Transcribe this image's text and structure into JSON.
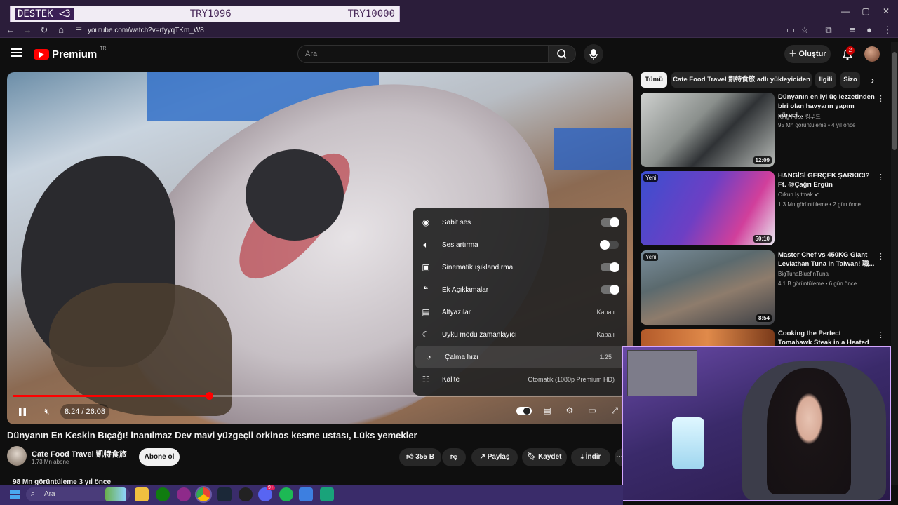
{
  "overlay_banner": {
    "left": "DESTEK <3",
    "mid": "TRY1096",
    "right": "TRY10000"
  },
  "browser": {
    "url": "youtube.com/watch?v=rfyyqTKm_W8",
    "window_buttons": [
      "—",
      "▢",
      "✕"
    ]
  },
  "header": {
    "logo": "Premium",
    "region": "TR",
    "search_placeholder": "Ara",
    "create_label": "Oluştur",
    "notifications": "2"
  },
  "player": {
    "time": "8:24 / 26:08",
    "progress": 0.322
  },
  "settings_menu": {
    "items": [
      {
        "label": "Sabit ses",
        "icon": "stable-volume-icon",
        "toggle": "on"
      },
      {
        "label": "Ses artırma",
        "icon": "volume-boost-icon",
        "toggle": "off"
      },
      {
        "label": "Sinematik ışıklandırma",
        "icon": "ambient-mode-icon",
        "toggle": "on"
      },
      {
        "label": "Ek Açıklamalar",
        "icon": "annotations-icon",
        "toggle": "on"
      },
      {
        "label": "Altyazılar",
        "icon": "subtitles-icon",
        "value": "Kapalı"
      },
      {
        "label": "Uyku modu zamanlayıcı",
        "icon": "sleep-timer-icon",
        "value": "Kapalı"
      },
      {
        "label": "Çalma hızı",
        "icon": "playback-speed-icon",
        "value": "1.25"
      },
      {
        "label": "Kalite",
        "icon": "quality-icon",
        "value": "Otomatik (1080p Premium HD)"
      }
    ]
  },
  "video": {
    "title": "Dünyanın En Keskin Bıçağı!  İnanılmaz Dev mavi yüzgeçli orkinos kesme ustası, Lüks yemekler",
    "channel": "Cate Food Travel 凱特食旅",
    "subscribers": "1,73 Mn abone",
    "subscribe_label": "Abone ol",
    "likes": "355 B",
    "share_label": "Paylaş",
    "save_label": "Kaydet",
    "download_label": "İndir",
    "views": "98 Mn görüntüleme  3 yıl önce"
  },
  "chips": [
    "Tümü",
    "Cate Food Travel 凱特食旅 adlı yükleyiciden",
    "İlgili",
    "Sizo"
  ],
  "recommendations": [
    {
      "title": "Dünyanın en iyi üç lezzetinden biri olan havyarın yapım süreci...",
      "channel": "King Food 킹푸드",
      "meta": "95 Mn görüntüleme • 4 yıl önce",
      "duration": "12:09",
      "badge": ""
    },
    {
      "title": "HANGİSİ GERÇEK ŞARKICI? Ft. @Çağrı Ergün",
      "channel": "Orkun Işıtmak ✔",
      "meta": "1,3 Mn görüntüleme • 2 gün önce",
      "duration": "50:10",
      "badge": "Yeni"
    },
    {
      "title": "Master Chef vs 450KG Giant Leviathan Tuna in Taiwan! 職...",
      "channel": "BigTunaBluefinTuna",
      "meta": "4,1 B görüntüleme • 6 gün önce",
      "duration": "8:54",
      "badge": "Yeni"
    },
    {
      "title": "Cooking the Perfect Tomahawk Steak in a Heated Forest Roc...",
      "channel": "",
      "meta": "",
      "duration": "",
      "badge": ""
    }
  ],
  "taskbar": {
    "search_placeholder": "Ara",
    "discord_badge": "9+"
  },
  "colors": {
    "accent_red": "#ff0000",
    "background": "#0f0f0f",
    "overlay_border": "#d3a6ff",
    "taskbar": "#3a2c6a"
  }
}
